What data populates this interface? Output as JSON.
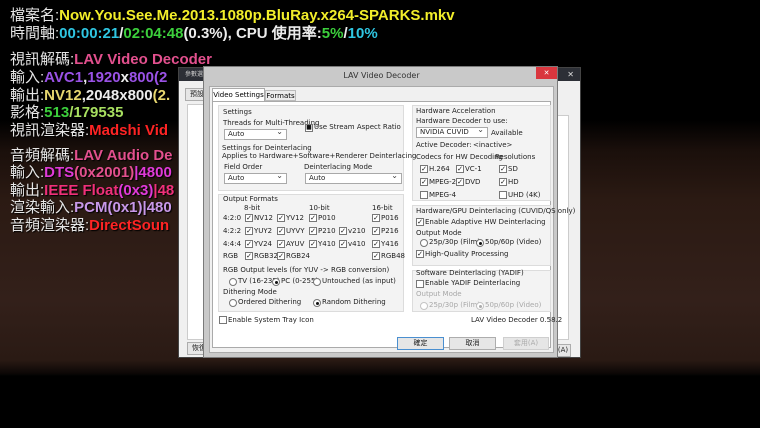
{
  "osd": {
    "file_label": "檔案名:",
    "file_name": "Now.You.See.Me.2013.1080p.BluRay.x264-SPARKS.mkv",
    "time_label": "時間軸:",
    "time_current": "00:00:21",
    "time_sep": "/",
    "time_total": "02:04:48",
    "time_pct": "(0.3%)",
    "cpu_label": ", CPU 使用率:",
    "cpu_1": "5%",
    "cpu_sep": "/",
    "cpu_2": "10%",
    "vdec_label": "視訊解碼:",
    "vdec": "LAV Video Decoder",
    "vin_label": "輸入:",
    "vin_codec": "AVC1",
    "vin_w": "1920",
    "vin_x": "x",
    "vin_h": "800",
    "vin_rest": "(2",
    "vout_label": "輸出:",
    "vout_fmt": "NV12",
    "vout_res": ",2048x800",
    "vout_rest": "(2.",
    "frames_label": "影格:",
    "frames_cur": "513",
    "frames_total": "/179535",
    "vrend_label": "視訊渲染器:",
    "vrend": "Madshi Vid",
    "adec_label": "音頻解碼:",
    "adec": "LAV Audio De",
    "ain_label": "輸入:",
    "ain_codec": "DTS",
    "ain_id": "(0x2001)",
    "ain_rest": "|4800",
    "aout_label": "輸出:",
    "aout_fmt": "IEEE Float",
    "aout_id": "(0x3)",
    "aout_rest": "|48",
    "rin_label": "渲染輸入:",
    "rin": "PCM(0x1)|480",
    "arend_label": "音頻渲染器:",
    "arend": "DirectSoun"
  },
  "parent": {
    "title": "參數選",
    "left_button": "預設",
    "bottom_button": "恢復",
    "apply_label": "(A)",
    "close": "✕"
  },
  "dialog": {
    "title": "LAV Video Decoder",
    "close": "✕",
    "tabs": [
      {
        "label": "Video Settings",
        "active": true
      },
      {
        "label": "Formats",
        "active": false
      }
    ],
    "settings": {
      "title": "Settings",
      "threads_label": "Threads for Multi-Threading",
      "threads_value": "Auto",
      "stream_aspect": {
        "label": "Use Stream Aspect Ratio",
        "state": "indeterminate"
      },
      "deint_title": "Settings for Deinterlacing",
      "deint_sub": "Applies to Hardware+Software+Renderer Deinterlacing",
      "field_order_label": "Field Order",
      "field_order_value": "Auto",
      "deint_mode_label": "Deinterlacing Mode",
      "deint_mode_value": "Auto"
    },
    "output_formats": {
      "title": "Output Formats",
      "headers": [
        "8-bit",
        "10-bit",
        "16-bit"
      ],
      "rows": [
        {
          "label": "4:2:0",
          "items": [
            {
              "label": "NV12",
              "checked": true
            },
            {
              "label": "YV12",
              "checked": true
            },
            {
              "label": "P010",
              "checked": true
            },
            {
              "label": "P016",
              "checked": true
            }
          ]
        },
        {
          "label": "4:2:2",
          "items": [
            {
              "label": "YUY2",
              "checked": true
            },
            {
              "label": "UYVY",
              "checked": true
            },
            {
              "label": "P210",
              "checked": true
            },
            {
              "label": "v210",
              "checked": true
            },
            {
              "label": "P216",
              "checked": true
            }
          ]
        },
        {
          "label": "4:4:4",
          "items": [
            {
              "label": "YV24",
              "checked": true
            },
            {
              "label": "AYUV",
              "checked": true
            },
            {
              "label": "Y410",
              "checked": true
            },
            {
              "label": "v410",
              "checked": true
            },
            {
              "label": "Y416",
              "checked": true
            }
          ]
        },
        {
          "label": "RGB",
          "items": [
            {
              "label": "RGB32",
              "checked": true
            },
            {
              "label": "RGB24",
              "checked": true
            },
            {
              "label": "RGB48",
              "checked": true
            }
          ]
        }
      ],
      "rgb_levels_label": "RGB Output levels (for YUV -> RGB conversion)",
      "rgb_levels": [
        "TV (16-235)",
        "PC (0-255)",
        "Untouched (as input)"
      ],
      "rgb_levels_selected": "PC (0-255)",
      "dither_label": "Dithering Mode",
      "dither": [
        "Ordered Dithering",
        "Random Dithering"
      ],
      "dither_selected": "Random Dithering"
    },
    "tray": {
      "label": "Enable System Tray Icon",
      "checked": false
    },
    "hw": {
      "title": "Hardware Acceleration",
      "decoder_label": "Hardware Decoder to use:",
      "decoder_value": "NVIDIA CUVID",
      "status": "Available",
      "active_label": "Active Decoder:",
      "active_value": "<inactive>",
      "codecs_label": "Codecs for HW Decoding",
      "res_label": "Resolutions",
      "codecs": [
        {
          "label": "H.264",
          "checked": true
        },
        {
          "label": "VC-1",
          "checked": true
        },
        {
          "label": "MPEG-2",
          "checked": true
        },
        {
          "label": "DVD",
          "checked": true
        },
        {
          "label": "MPEG-4",
          "checked": false
        }
      ],
      "resolutions": [
        {
          "label": "SD",
          "checked": true
        },
        {
          "label": "HD",
          "checked": true
        },
        {
          "label": "UHD (4K)",
          "checked": false
        }
      ]
    },
    "hw_deint": {
      "title": "Hardware/GPU Deinterlacing (CUVID/QS only)",
      "adaptive": {
        "label": "Enable Adaptive HW Deinterlacing",
        "checked": true
      },
      "mode_label": "Output Mode",
      "modes": [
        "25p/30p (Film)",
        "50p/60p (Video)"
      ],
      "mode_selected": "50p/60p (Video)",
      "hq": {
        "label": "High-Quality Processing",
        "checked": true
      }
    },
    "sw_deint": {
      "title": "Software Deinterlacing (YADIF)",
      "yadif": {
        "label": "Enable YADIF Deinterlacing",
        "checked": false
      },
      "mode_label": "Output Mode",
      "modes": [
        "25p/30p (Film)",
        "50p/60p (Video)"
      ],
      "mode_selected": "50p/60p (Video)"
    },
    "version": "LAV Video Decoder 0.58.2",
    "buttons": {
      "ok": "確定",
      "cancel": "取消",
      "apply": "套用(A)"
    },
    "colors": {
      "close": "#d9363e"
    }
  }
}
